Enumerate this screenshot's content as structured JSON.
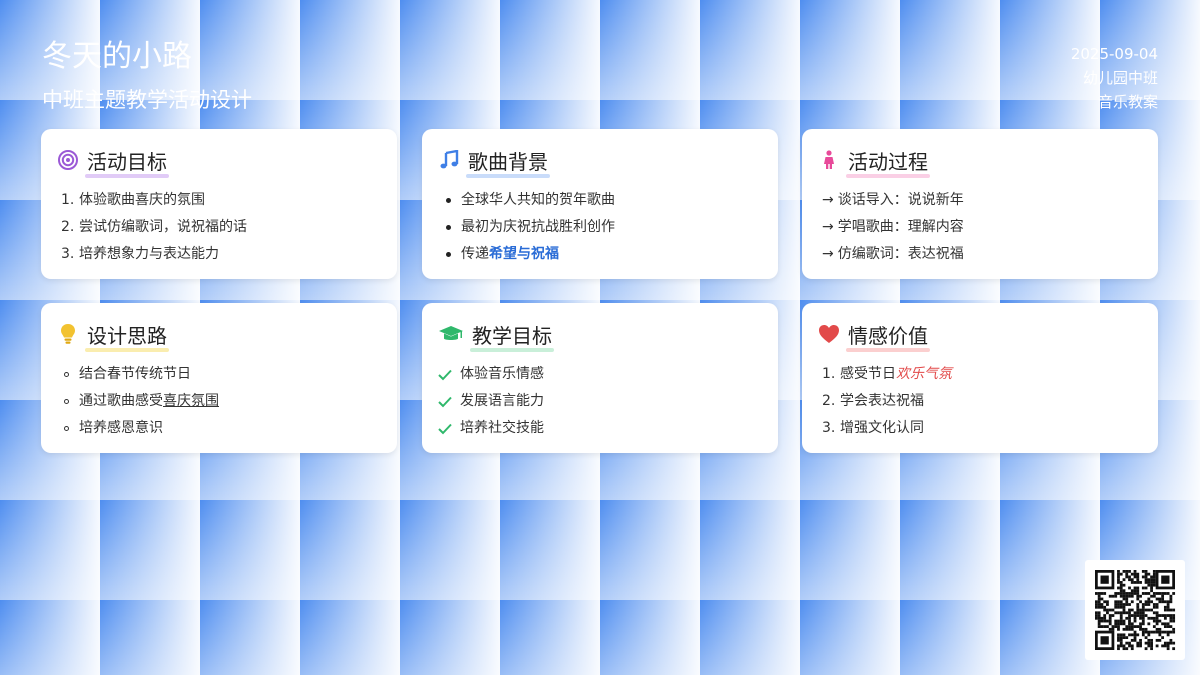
{
  "header": {
    "title": "冬天的小路",
    "subtitle": "中班主题教学活动设计",
    "date": "2025-09-04",
    "class_name": "幼儿园中班",
    "plan_type": "音乐教案"
  },
  "cards": {
    "goals": {
      "title": "活动目标",
      "icon": "target-icon",
      "items": [
        "体验歌曲喜庆的氛围",
        "尝试仿编歌词，说祝福的话",
        "培养想象力与表达能力"
      ]
    },
    "background": {
      "title": "歌曲背景",
      "icon": "music-note-icon",
      "items": [
        "全球华人共知的贺年歌曲",
        "最初为庆祝抗战胜利创作"
      ],
      "item3_prefix": "传递",
      "item3_highlight": "希望与祝福"
    },
    "process": {
      "title": "活动过程",
      "icon": "child-icon",
      "items": [
        "谈话导入：说说新年",
        "学唱歌曲：理解内容",
        "仿编歌词：表达祝福"
      ]
    },
    "design": {
      "title": "设计思路",
      "icon": "lightbulb-icon",
      "items": [
        "结合春节传统节日",
        "培养感恩意识"
      ],
      "item2_prefix": "通过歌曲感受",
      "item2_highlight": "喜庆氛围"
    },
    "teaching": {
      "title": "教学目标",
      "icon": "graduation-cap-icon",
      "items": [
        "体验音乐情感",
        "发展语言能力",
        "培养社交技能"
      ]
    },
    "emotion": {
      "title": "情感价值",
      "icon": "heart-icon",
      "item1_prefix": "感受节日",
      "item1_highlight": "欢乐气氛",
      "items": [
        "学会表达祝福",
        "增强文化认同"
      ]
    }
  },
  "colors": {
    "purple": "#9b59d6",
    "blue": "#3f7fe6",
    "pink": "#e84a9a",
    "yellow": "#f2c230",
    "green": "#2fb86b",
    "red": "#e24a4a"
  },
  "qr_icon": "qr-code-icon"
}
